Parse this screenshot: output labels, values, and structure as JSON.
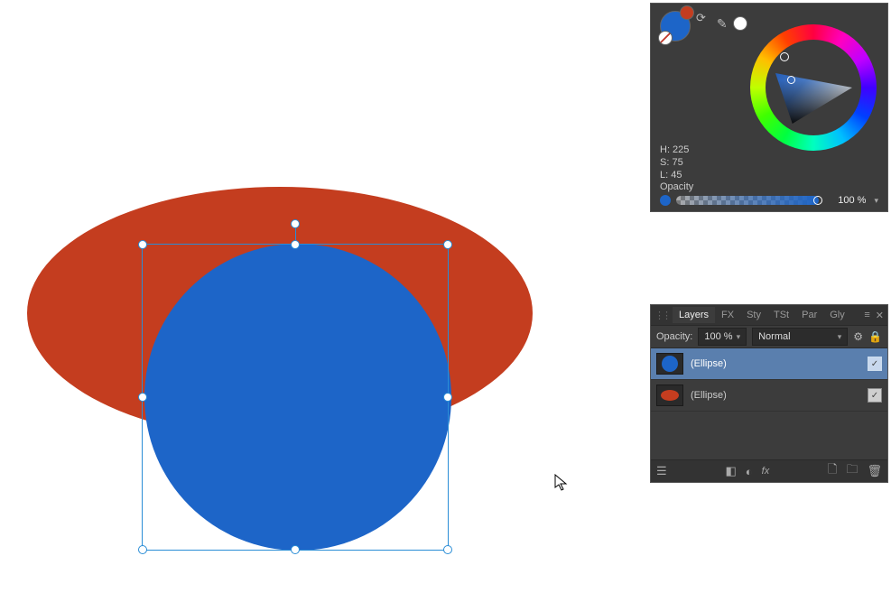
{
  "canvas": {
    "shapes": [
      {
        "type": "ellipse",
        "fill": "#c43d1f"
      },
      {
        "type": "ellipse",
        "fill": "#1d65c8",
        "selected": true
      }
    ]
  },
  "colour_panel": {
    "current_fill": "#1d65c8",
    "hsl": {
      "h_label": "H: 225",
      "s_label": "S: 75",
      "l_label": "L: 45"
    },
    "opacity": {
      "label": "Opacity",
      "value": "100 %"
    }
  },
  "layers_panel": {
    "tabs": {
      "layers": "Layers",
      "fx": "FX",
      "sty": "Sty",
      "tst": "TSt",
      "par": "Par",
      "gly": "Gly"
    },
    "opacity_label": "Opacity:",
    "opacity_value": "100 %",
    "blend_mode": "Normal",
    "layers": [
      {
        "name": "(Ellipse)",
        "color": "#1d65c8",
        "selected": true,
        "visible": true
      },
      {
        "name": "(Ellipse)",
        "color": "#c43d1f",
        "selected": false,
        "visible": true
      }
    ]
  }
}
